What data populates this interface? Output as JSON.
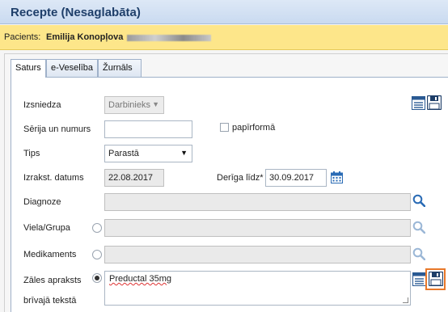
{
  "window": {
    "title": "Recepte (Nesaglabāta)"
  },
  "patient": {
    "label": "Pacients:",
    "name": "Emilija Konopļova"
  },
  "tabs": [
    {
      "label": "Saturs",
      "active": true
    },
    {
      "label": "e-Veselība",
      "active": false
    },
    {
      "label": "Žurnāls",
      "active": false
    }
  ],
  "form": {
    "issuer": {
      "label": "Izsniedza",
      "value": "Darbinieks"
    },
    "series": {
      "label": "Sērija un numurs",
      "value": ""
    },
    "paper": {
      "label": "papīrformā",
      "checked": false
    },
    "type": {
      "label": "Tips",
      "value": "Parastā"
    },
    "issue_date": {
      "label": "Izrakst. datums",
      "value": "22.08.2017"
    },
    "valid_until": {
      "label": "Derīga līdz*",
      "value": "30.09.2017"
    },
    "diagnosis": {
      "label": "Diagnoze",
      "value": ""
    },
    "substance": {
      "label": "Viela/Grupa",
      "value": ""
    },
    "medication": {
      "label": "Medikaments",
      "value": ""
    },
    "free_text": {
      "label_line1": "Zāles apraksts",
      "label_line2": "brīvajā tekstā",
      "value": "Preductal 35mg",
      "selected": true
    }
  },
  "colors": {
    "title": "#1f3f6a",
    "patient_bar": "#fde68a",
    "focus": "#e8782a",
    "search_icon": "#2a6bb5"
  }
}
